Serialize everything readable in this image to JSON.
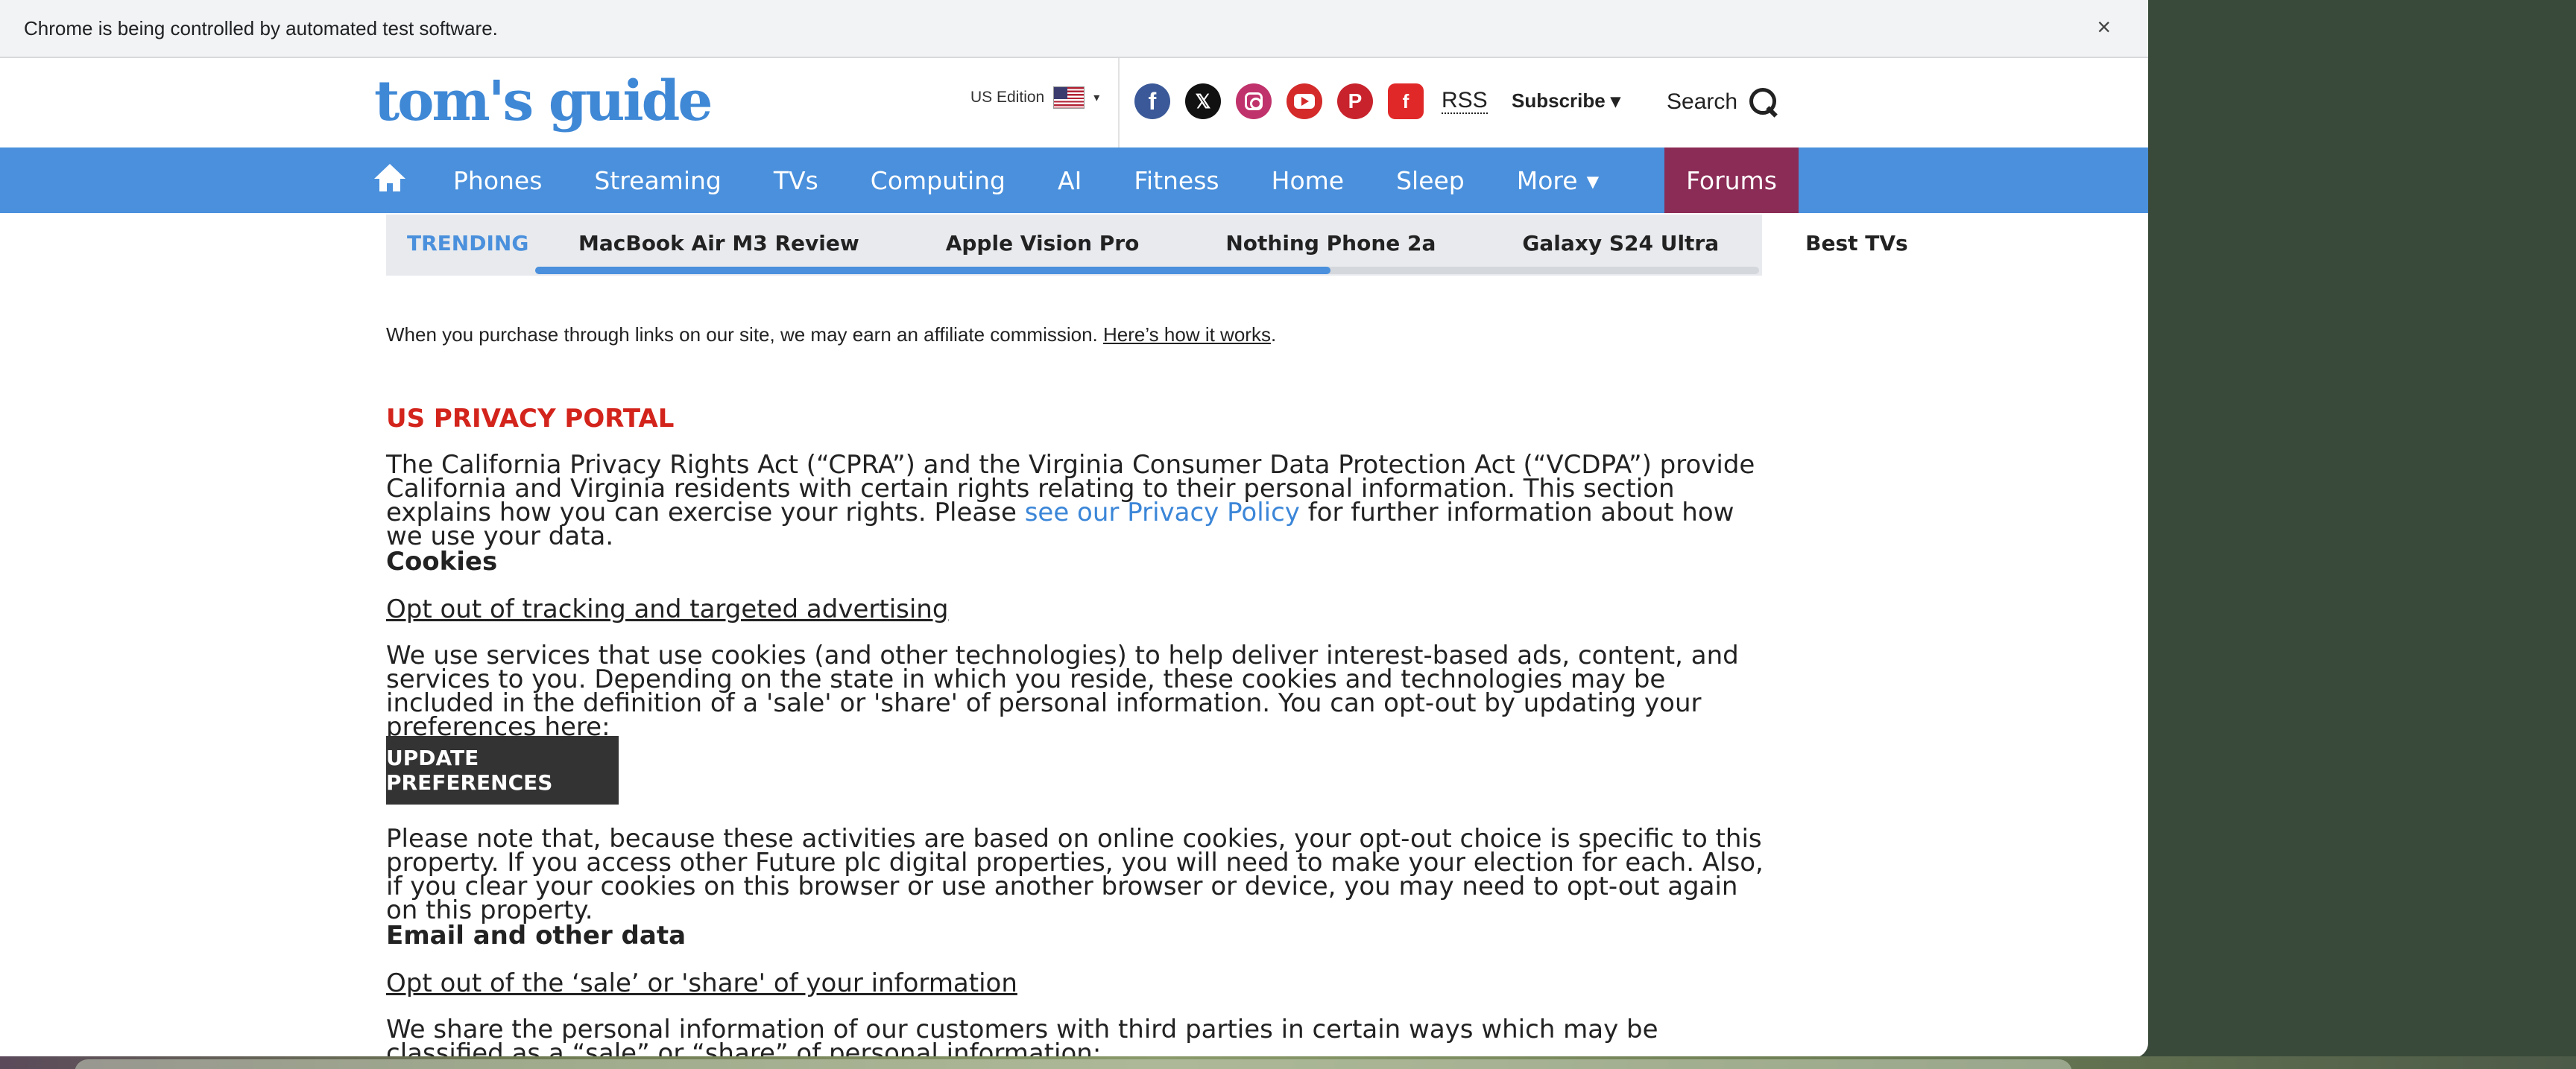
{
  "automation_bar": {
    "message": "Chrome is being controlled by automated test software.",
    "close_symbol": "×"
  },
  "header": {
    "logo": "tom's guide",
    "edition_label": "US Edition",
    "edition_caret": "▾",
    "social": {
      "facebook": "f",
      "x": "𝕏",
      "pinterest": "P",
      "flipboard": "f",
      "rss": "RSS"
    },
    "subscribe_label": "Subscribe ▾",
    "search_label": "Search"
  },
  "nav": {
    "items": [
      "Phones",
      "Streaming",
      "TVs",
      "Computing",
      "AI",
      "Fitness",
      "Home",
      "Sleep"
    ],
    "more_label": "More",
    "more_caret": "▾",
    "forums_label": "Forums",
    "colors": {
      "bar": "#4a90dc",
      "forums": "#8b2c56"
    }
  },
  "trending": {
    "label": "TRENDING",
    "items": [
      "MacBook Air M3 Review",
      "Apple Vision Pro",
      "Nothing Phone 2a",
      "Galaxy S24 Ultra",
      "Best TVs"
    ],
    "scroll_progress": 0.65
  },
  "affiliate": {
    "text": "When you purchase through links on our site, we may earn an affiliate commission.",
    "link_text": "Here’s how it works",
    "end": "."
  },
  "privacy": {
    "title": "US PRIVACY PORTAL",
    "intro_before": "The California Privacy Rights Act (“CPRA”) and the Virginia Consumer Data Protection Act (“VCDPA”) provide California and Virginia residents with certain rights relating to their personal information. This section explains how you can exercise your rights. Please ",
    "intro_link": "see our Privacy Policy",
    "intro_after": " for further information about how we use your data.",
    "cookies_heading": "Cookies",
    "opt_out_tracking": "Opt out of tracking and targeted advertising",
    "cookies_text": "We use services that use cookies (and other technologies) to help deliver interest-based ads, content, and services to you. Depending on the state in which you reside, these cookies and technologies may be included in the definition of a 'sale' or 'share' of personal information. You can opt-out by updating your preferences here:",
    "update_button": "UPDATE PREFERENCES",
    "note_text": "Please note that, because these activities are based on online cookies, your opt-out choice is specific to this property. If you access other Future plc digital properties, you will need to make your election for each. Also, if you clear your cookies on this browser or use another browser or device, you may need to opt-out again on this property.",
    "email_heading": "Email and other data",
    "opt_out_sale": "Opt out of the ‘sale’ or 'share' of your information",
    "share_text": "We share the personal information of our customers with third parties in certain ways which may be classified as a “sale” or “share” of personal information:"
  }
}
